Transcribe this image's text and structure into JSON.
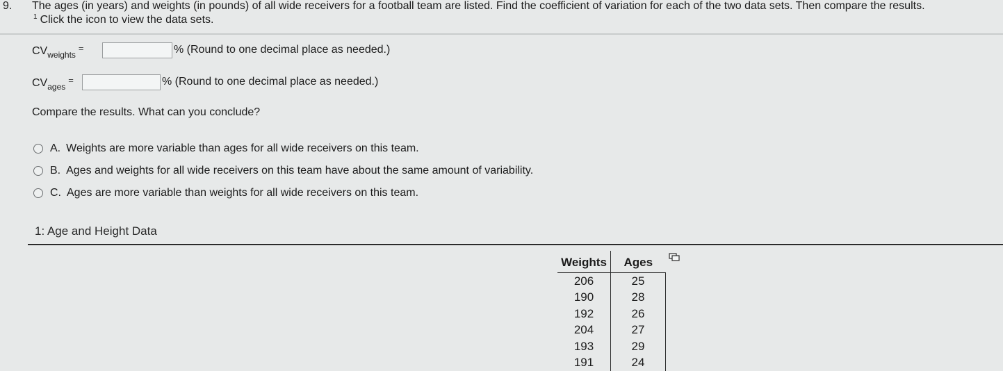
{
  "question": {
    "number": "9.",
    "text": "The ages (in years) and weights (in pounds) of all wide receivers for a football team are listed. Find the coefficient of variation for each of the two data sets. Then compare the results.",
    "footnote_marker": "1",
    "note": "Click the icon to view the data sets."
  },
  "cv_weights": {
    "label": "CV",
    "subscript": "weights",
    "equals": "=",
    "value": "",
    "after": "% (Round to one decimal place as needed.)"
  },
  "cv_ages": {
    "label": "CV",
    "subscript": "ages",
    "equals": "=",
    "value": "",
    "after": "% (Round to one decimal place as needed.)"
  },
  "compare_prompt": "Compare the results. What can you conclude?",
  "options": [
    {
      "letter": "A.",
      "text": "Weights are more variable than ages for all wide receivers on this team."
    },
    {
      "letter": "B.",
      "text": "Ages and weights for all wide receivers on this team have about the same amount of variability."
    },
    {
      "letter": "C.",
      "text": "Ages are more variable than weights for all wide receivers on this team."
    }
  ],
  "data_panel": {
    "title": "1: Age and Height Data",
    "columns": [
      "Weights",
      "Ages"
    ],
    "rows": [
      [
        "206",
        "25"
      ],
      [
        "190",
        "28"
      ],
      [
        "192",
        "26"
      ],
      [
        "204",
        "27"
      ],
      [
        "193",
        "29"
      ],
      [
        "191",
        "24"
      ]
    ],
    "copy_icon": "copy-icon"
  }
}
